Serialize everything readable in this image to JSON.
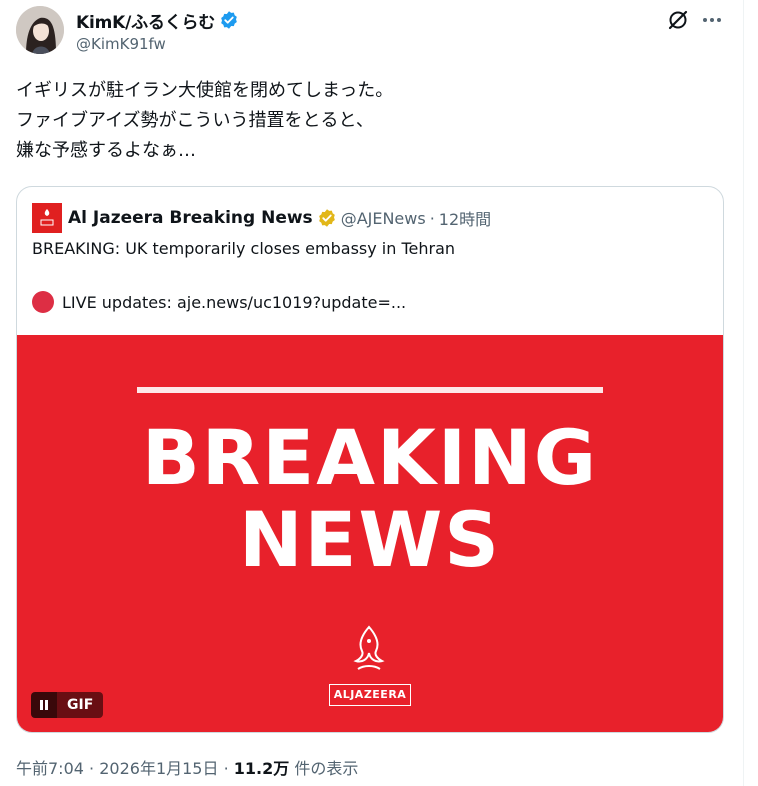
{
  "author": {
    "display_name": "KimK/ふるくらむ",
    "handle": "@KimK91fw",
    "verified_color": "#1d9bf0"
  },
  "tweet": {
    "lines": [
      "イギリスが駐イラン大使館を閉めてしまった。",
      "ファイブアイズ勢がこういう措置をとると、",
      "嫌な予感するよなぁ…"
    ]
  },
  "quote": {
    "name": "Al Jazeera Breaking News",
    "handle": "@AJENews",
    "separator": "·",
    "time": "12時間",
    "text_line1": "BREAKING: UK temporarily closes embassy in Tehran",
    "text_line2": "LIVE updates: aje.news/uc1019?update=...",
    "verified_color": "#e2b719",
    "media": {
      "title_line1": "BREAKING",
      "title_line2": "NEWS",
      "logo_text": "ALJAZEERA",
      "background_color": "#e8212b",
      "gif_label": "GIF"
    }
  },
  "meta": {
    "time": "午前7:04",
    "sep1": "·",
    "date": "2026年1月15日",
    "sep2": "·",
    "views_count": "11.2万",
    "views_label": "件の表示"
  },
  "icons": {
    "grok": "grok-icon",
    "more": "more-icon"
  }
}
